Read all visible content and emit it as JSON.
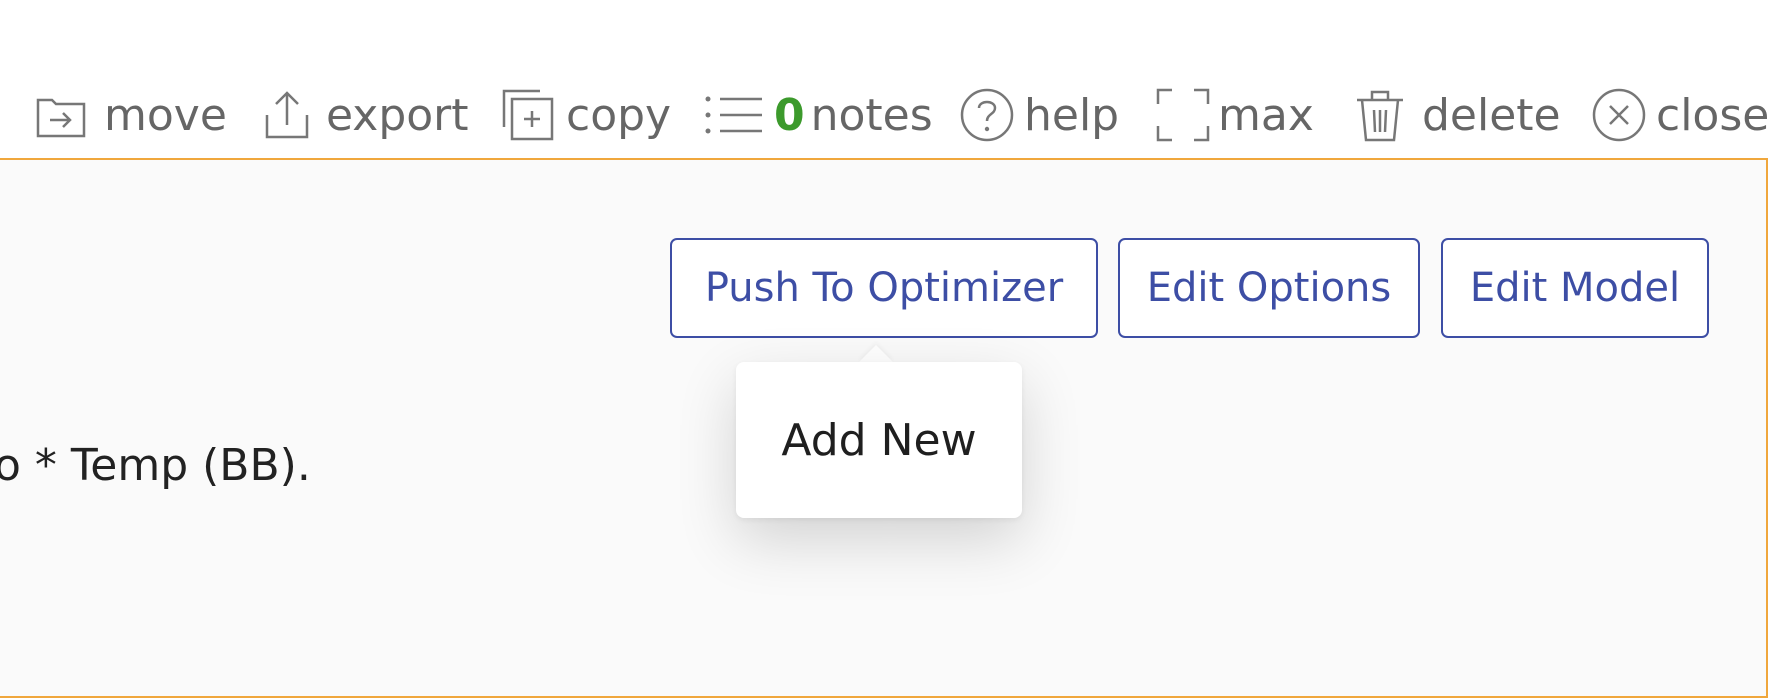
{
  "toolbar": {
    "move_label": "move",
    "export_label": "export",
    "copy_label": "copy",
    "notes_count": "0",
    "notes_label": "notes",
    "help_label": "help",
    "max_label": "max",
    "delete_label": "delete",
    "close_label": "close"
  },
  "actions": {
    "push_label": "Push To Optimizer",
    "edit_options_label": "Edit Options",
    "edit_model_label": "Edit Model"
  },
  "tooltip": {
    "label": "Add New"
  },
  "content": {
    "text": "o * Temp (BB)."
  },
  "colors": {
    "accent_border": "#f0a73c",
    "button_blue": "#3d4ea5",
    "notes_count_green": "#3c9a2c",
    "toolbar_gray": "#666666"
  },
  "icons": [
    "move-icon",
    "export-icon",
    "copy-icon",
    "notes-icon",
    "help-icon",
    "max-icon",
    "delete-icon",
    "close-icon"
  ]
}
